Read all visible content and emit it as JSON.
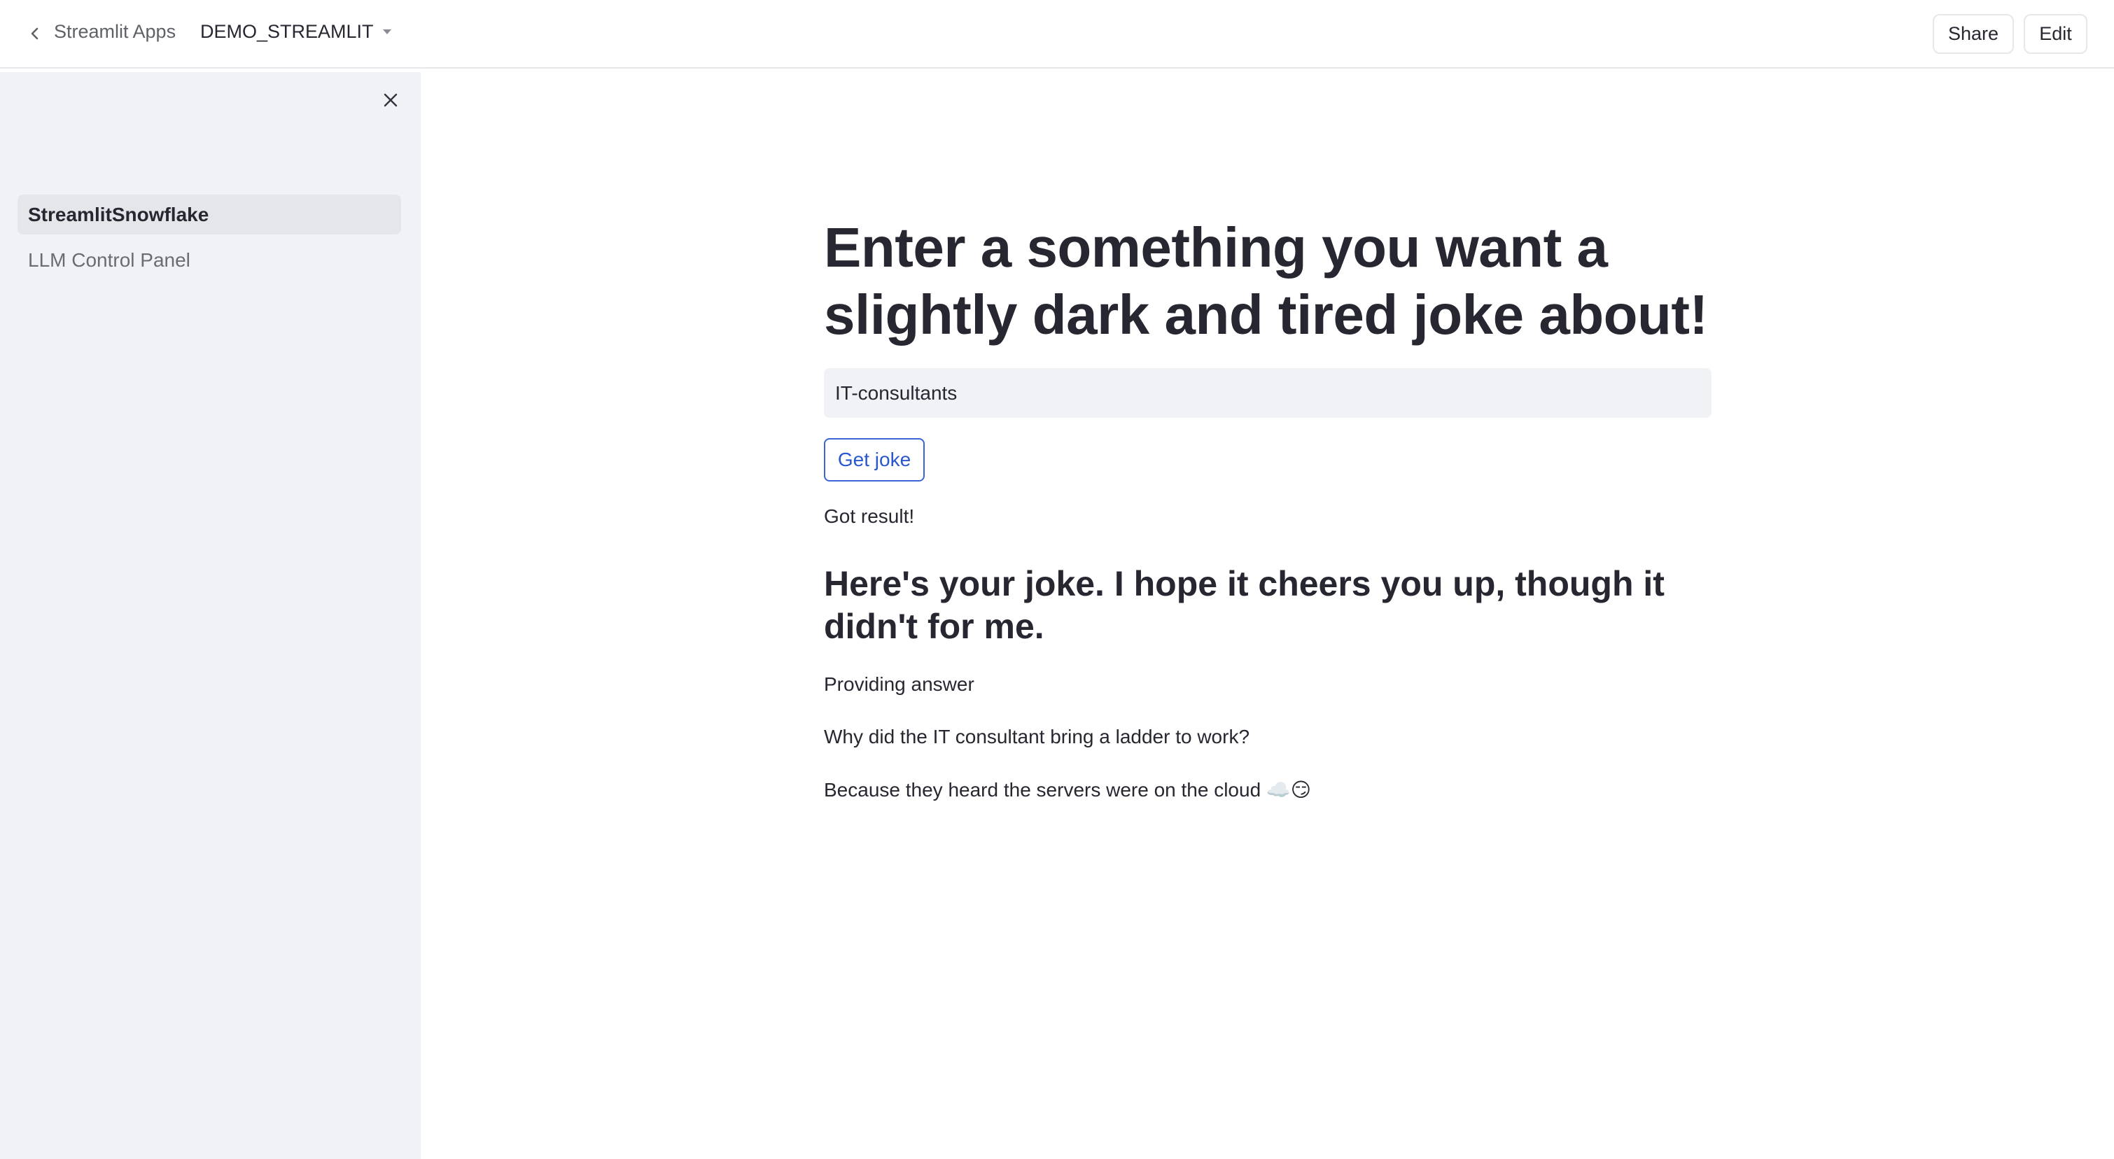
{
  "header": {
    "apps_link": "Streamlit Apps",
    "app_name": "DEMO_STREAMLIT",
    "share_label": "Share",
    "edit_label": "Edit"
  },
  "sidebar": {
    "items": [
      {
        "label": "StreamlitSnowflake",
        "active": true
      },
      {
        "label": "LLM Control Panel",
        "active": false
      }
    ]
  },
  "main": {
    "title": "Enter a something you want a slightly dark and tired joke about!",
    "input_value": "IT-consultants",
    "button_label": "Get joke",
    "status": "Got result!",
    "subheader": "Here's your joke. I hope it cheers you up, though it didn't for me.",
    "paragraphs": [
      "Providing answer",
      "Why did the IT consultant bring a ladder to work?",
      "Because they heard the servers were on the cloud ☁️😏"
    ]
  },
  "colors": {
    "accent": "#2a57cf",
    "sidebar_bg": "#f0f2f6",
    "text": "#262730"
  }
}
